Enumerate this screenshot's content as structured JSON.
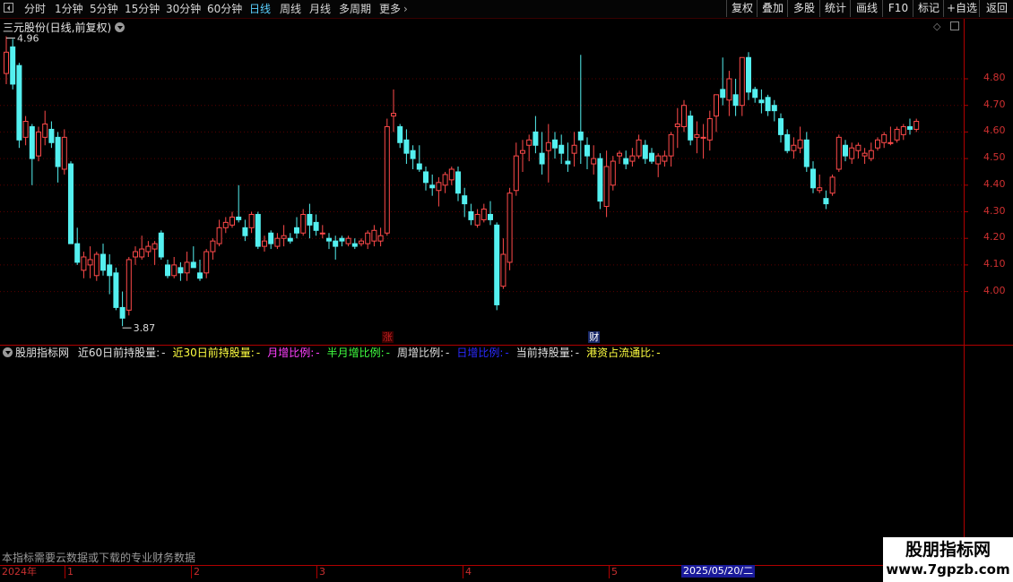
{
  "toolbar": {
    "periods": [
      "分时",
      "1分钟",
      "5分钟",
      "15分钟",
      "30分钟",
      "60分钟",
      "日线",
      "周线",
      "月线",
      "多周期",
      "更多"
    ],
    "active_period": "日线",
    "buttons": [
      "复权",
      "叠加",
      "多股",
      "统计",
      "画线",
      "F10",
      "标记",
      "+自选",
      "返回"
    ]
  },
  "chart": {
    "title": "三元股份(日线,前复权)",
    "high_label": "4.96",
    "low_label": "3.87",
    "price_ticks": [
      "4.80",
      "4.70",
      "4.60",
      "4.50",
      "4.40",
      "4.30",
      "4.20",
      "4.10",
      "4.00"
    ],
    "event_markers": [
      {
        "text": "涨",
        "color": "#c02020",
        "bg": "#3a0000"
      },
      {
        "text": "财",
        "color": "#ffffff",
        "bg": "#1a2a6a"
      }
    ],
    "colors": {
      "up": "#ff4a4a",
      "down": "#54f0f0",
      "grid": "#5a0000",
      "axis": "#b00000"
    }
  },
  "indicator": {
    "name": "股朋指标网",
    "fields": [
      {
        "label": "近60日前持股量:",
        "value": "-",
        "color": "#e0e0e0"
      },
      {
        "label": "近30日前持股量:",
        "value": "-",
        "color": "#ffff40"
      },
      {
        "label": "月增比例:",
        "value": "-",
        "color": "#ff40ff"
      },
      {
        "label": "半月增比例:",
        "value": "-",
        "color": "#40ff40"
      },
      {
        "label": "周增比例:",
        "value": "-",
        "color": "#e0e0e0"
      },
      {
        "label": "日增比例:",
        "value": "-",
        "color": "#2a2aff"
      },
      {
        "label": "当前持股量:",
        "value": "-",
        "color": "#e0e0e0"
      },
      {
        "label": "港资占流通比:",
        "value": "-",
        "color": "#ffff40"
      }
    ]
  },
  "status_message": "本指标需要云数据或下载的专业财务数据",
  "date_axis": {
    "labels": [
      "2024年",
      "1",
      "2",
      "3",
      "4",
      "5"
    ],
    "cursor_date": "2025/05/20/二"
  },
  "watermark": {
    "line1": "股朋指标网",
    "line2": "www.7gpzb.com"
  },
  "chart_data": {
    "type": "candlestick",
    "title": "三元股份(日线,前复权)",
    "ylim": [
      3.87,
      4.96
    ],
    "series": [
      {
        "name": "三元股份",
        "ohlc": [
          [
            4.82,
            4.96,
            4.78,
            4.9
          ],
          [
            4.92,
            4.95,
            4.76,
            4.78
          ],
          [
            4.85,
            4.86,
            4.54,
            4.57
          ],
          [
            4.58,
            4.66,
            4.55,
            4.64
          ],
          [
            4.62,
            4.63,
            4.4,
            4.5
          ],
          [
            4.51,
            4.62,
            4.49,
            4.6
          ],
          [
            4.58,
            4.68,
            4.55,
            4.63
          ],
          [
            4.61,
            4.64,
            4.54,
            4.56
          ],
          [
            4.58,
            4.6,
            4.41,
            4.47
          ],
          [
            4.46,
            4.61,
            4.44,
            4.58
          ],
          [
            4.48,
            4.49,
            4.18,
            4.18
          ],
          [
            4.18,
            4.24,
            4.1,
            4.11
          ],
          [
            4.08,
            4.15,
            4.05,
            4.13
          ],
          [
            4.1,
            4.17,
            4.05,
            4.12
          ],
          [
            4.06,
            4.15,
            4.04,
            4.14
          ],
          [
            4.14,
            4.18,
            4.06,
            4.08
          ],
          [
            4.1,
            4.14,
            3.99,
            4.06
          ],
          [
            4.07,
            4.09,
            3.93,
            3.94
          ],
          [
            3.94,
            4.0,
            3.87,
            3.9
          ],
          [
            3.93,
            4.13,
            3.91,
            4.12
          ],
          [
            4.13,
            4.17,
            4.1,
            4.15
          ],
          [
            4.13,
            4.21,
            4.12,
            4.16
          ],
          [
            4.15,
            4.19,
            4.13,
            4.17
          ],
          [
            4.16,
            4.19,
            4.1,
            4.18
          ],
          [
            4.22,
            4.23,
            4.12,
            4.13
          ],
          [
            4.1,
            4.12,
            4.05,
            4.06
          ],
          [
            4.06,
            4.13,
            4.05,
            4.1
          ],
          [
            4.09,
            4.11,
            4.04,
            4.07
          ],
          [
            4.07,
            4.15,
            4.04,
            4.11
          ],
          [
            4.11,
            4.17,
            4.09,
            4.09
          ],
          [
            4.07,
            4.12,
            4.04,
            4.05
          ],
          [
            4.07,
            4.16,
            4.05,
            4.15
          ],
          [
            4.15,
            4.2,
            4.12,
            4.19
          ],
          [
            4.18,
            4.27,
            4.17,
            4.24
          ],
          [
            4.24,
            4.28,
            4.22,
            4.26
          ],
          [
            4.25,
            4.3,
            4.24,
            4.28
          ],
          [
            4.28,
            4.4,
            4.26,
            4.27
          ],
          [
            4.24,
            4.27,
            4.19,
            4.21
          ],
          [
            4.24,
            4.3,
            4.22,
            4.29
          ],
          [
            4.29,
            4.3,
            4.16,
            4.17
          ],
          [
            4.17,
            4.21,
            4.15,
            4.19
          ],
          [
            4.22,
            4.23,
            4.16,
            4.18
          ],
          [
            4.17,
            4.22,
            4.16,
            4.2
          ],
          [
            4.2,
            4.25,
            4.17,
            4.21
          ],
          [
            4.2,
            4.22,
            4.18,
            4.19
          ],
          [
            4.24,
            4.28,
            4.2,
            4.22
          ],
          [
            4.22,
            4.31,
            4.21,
            4.29
          ],
          [
            4.29,
            4.33,
            4.2,
            4.25
          ],
          [
            4.26,
            4.29,
            4.21,
            4.23
          ],
          [
            4.22,
            4.25,
            4.2,
            4.22
          ],
          [
            4.2,
            4.22,
            4.16,
            4.19
          ],
          [
            4.19,
            4.21,
            4.12,
            4.17
          ],
          [
            4.2,
            4.21,
            4.17,
            4.19
          ],
          [
            4.18,
            4.21,
            4.17,
            4.2
          ],
          [
            4.18,
            4.2,
            4.16,
            4.17
          ],
          [
            4.18,
            4.2,
            4.17,
            4.19
          ],
          [
            4.18,
            4.23,
            4.16,
            4.22
          ],
          [
            4.19,
            4.25,
            4.17,
            4.23
          ],
          [
            4.19,
            4.24,
            4.17,
            4.21
          ],
          [
            4.22,
            4.65,
            4.21,
            4.62
          ],
          [
            4.66,
            4.76,
            4.6,
            4.67
          ],
          [
            4.62,
            4.63,
            4.54,
            4.56
          ],
          [
            4.57,
            4.61,
            4.48,
            4.52
          ],
          [
            4.53,
            4.55,
            4.46,
            4.5
          ],
          [
            4.48,
            4.55,
            4.45,
            4.46
          ],
          [
            4.45,
            4.47,
            4.38,
            4.41
          ],
          [
            4.4,
            4.44,
            4.36,
            4.39
          ],
          [
            4.38,
            4.43,
            4.32,
            4.41
          ],
          [
            4.4,
            4.45,
            4.37,
            4.44
          ],
          [
            4.42,
            4.47,
            4.4,
            4.46
          ],
          [
            4.45,
            4.47,
            4.34,
            4.37
          ],
          [
            4.36,
            4.39,
            4.28,
            4.33
          ],
          [
            4.3,
            4.33,
            4.25,
            4.27
          ],
          [
            4.25,
            4.31,
            4.24,
            4.29
          ],
          [
            4.27,
            4.33,
            4.26,
            4.31
          ],
          [
            4.29,
            4.34,
            4.25,
            4.27
          ],
          [
            4.25,
            4.26,
            3.93,
            3.95
          ],
          [
            4.02,
            4.2,
            4.01,
            4.14
          ],
          [
            4.11,
            4.39,
            4.08,
            4.37
          ],
          [
            4.38,
            4.56,
            4.36,
            4.51
          ],
          [
            4.52,
            4.57,
            4.45,
            4.53
          ],
          [
            4.55,
            4.59,
            4.49,
            4.57
          ],
          [
            4.6,
            4.66,
            4.52,
            4.55
          ],
          [
            4.52,
            4.6,
            4.44,
            4.48
          ],
          [
            4.53,
            4.63,
            4.41,
            4.56
          ],
          [
            4.57,
            4.6,
            4.5,
            4.54
          ],
          [
            4.55,
            4.59,
            4.48,
            4.52
          ],
          [
            4.49,
            4.56,
            4.45,
            4.48
          ],
          [
            4.52,
            4.6,
            4.47,
            4.55
          ],
          [
            4.6,
            4.89,
            4.48,
            4.57
          ],
          [
            4.55,
            4.58,
            4.46,
            4.51
          ],
          [
            4.48,
            4.55,
            4.44,
            4.5
          ],
          [
            4.5,
            4.52,
            4.31,
            4.34
          ],
          [
            4.32,
            4.53,
            4.28,
            4.47
          ],
          [
            4.4,
            4.51,
            4.38,
            4.49
          ],
          [
            4.51,
            4.53,
            4.48,
            4.52
          ],
          [
            4.5,
            4.53,
            4.46,
            4.48
          ],
          [
            4.49,
            4.54,
            4.47,
            4.51
          ],
          [
            4.51,
            4.59,
            4.5,
            4.57
          ],
          [
            4.55,
            4.57,
            4.48,
            4.5
          ],
          [
            4.52,
            4.54,
            4.48,
            4.49
          ],
          [
            4.48,
            4.52,
            4.43,
            4.51
          ],
          [
            4.49,
            4.53,
            4.47,
            4.51
          ],
          [
            4.51,
            4.6,
            4.47,
            4.59
          ],
          [
            4.62,
            4.69,
            4.54,
            4.63
          ],
          [
            4.62,
            4.72,
            4.6,
            4.7
          ],
          [
            4.66,
            4.68,
            4.55,
            4.57
          ],
          [
            4.58,
            4.64,
            4.52,
            4.59
          ],
          [
            4.58,
            4.63,
            4.5,
            4.58
          ],
          [
            4.57,
            4.68,
            4.53,
            4.65
          ],
          [
            4.66,
            4.73,
            4.6,
            4.74
          ],
          [
            4.76,
            4.88,
            4.7,
            4.73
          ],
          [
            4.72,
            4.83,
            4.66,
            4.8
          ],
          [
            4.74,
            4.8,
            4.66,
            4.7
          ],
          [
            4.7,
            4.88,
            4.66,
            4.88
          ],
          [
            4.88,
            4.9,
            4.72,
            4.75
          ],
          [
            4.76,
            4.77,
            4.71,
            4.73
          ],
          [
            4.72,
            4.76,
            4.67,
            4.71
          ],
          [
            4.73,
            4.74,
            4.66,
            4.68
          ],
          [
            4.7,
            4.72,
            4.64,
            4.68
          ],
          [
            4.65,
            4.67,
            4.56,
            4.59
          ],
          [
            4.59,
            4.61,
            4.52,
            4.53
          ],
          [
            4.53,
            4.58,
            4.5,
            4.55
          ],
          [
            4.54,
            4.62,
            4.52,
            4.57
          ],
          [
            4.57,
            4.6,
            4.45,
            4.47
          ],
          [
            4.46,
            4.49,
            4.37,
            4.39
          ],
          [
            4.38,
            4.44,
            4.37,
            4.39
          ],
          [
            4.35,
            4.38,
            4.31,
            4.33
          ],
          [
            4.37,
            4.44,
            4.36,
            4.43
          ],
          [
            4.46,
            4.59,
            4.45,
            4.58
          ],
          [
            4.55,
            4.57,
            4.49,
            4.51
          ],
          [
            4.5,
            4.56,
            4.48,
            4.54
          ],
          [
            4.53,
            4.56,
            4.5,
            4.55
          ],
          [
            4.51,
            4.54,
            4.48,
            4.52
          ],
          [
            4.5,
            4.56,
            4.49,
            4.53
          ],
          [
            4.54,
            4.58,
            4.53,
            4.57
          ],
          [
            4.56,
            4.6,
            4.54,
            4.59
          ],
          [
            4.56,
            4.62,
            4.55,
            4.56
          ],
          [
            4.57,
            4.62,
            4.56,
            4.61
          ],
          [
            4.59,
            4.63,
            4.57,
            4.62
          ],
          [
            4.62,
            4.65,
            4.59,
            4.61
          ],
          [
            4.61,
            4.65,
            4.6,
            4.64
          ]
        ]
      }
    ]
  }
}
